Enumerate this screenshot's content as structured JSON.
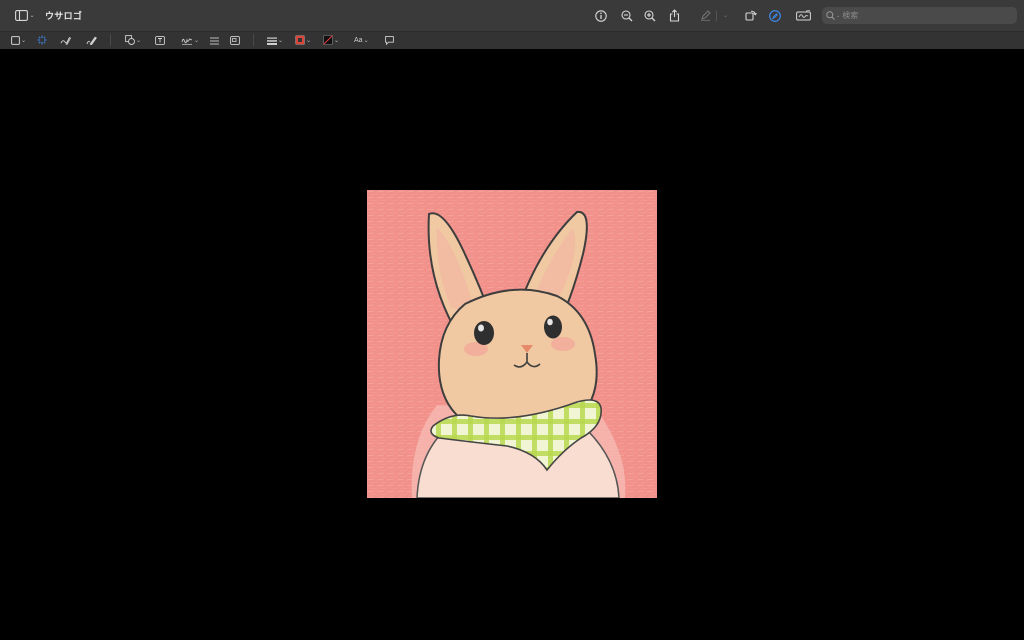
{
  "window": {
    "title": "ウサロゴ"
  },
  "toolbar": {
    "search_placeholder": "検索",
    "icons": [
      "sidebar-toggle-icon",
      "info-icon",
      "zoom-out-icon",
      "zoom-in-icon",
      "share-icon",
      "highlight-pen-icon",
      "rotate-icon",
      "markup-icon",
      "signature-icon",
      "search-icon"
    ]
  },
  "markup": {
    "font_button_label": "Aa",
    "border_color": "#d9473a",
    "fill_color": "#111111",
    "icons": [
      "rect-select-icon",
      "smart-lasso-icon",
      "sketch-icon",
      "draw-icon",
      "shapes-icon",
      "text-box-icon",
      "signature-tool-icon",
      "adjust-color-icon",
      "adjust-size-icon",
      "shape-style-icon",
      "border-color-icon",
      "fill-color-icon",
      "text-style-icon",
      "note-icon"
    ]
  },
  "document": {
    "image": "rabbit-with-plaid-scarf",
    "background_color": "#f2908a"
  }
}
